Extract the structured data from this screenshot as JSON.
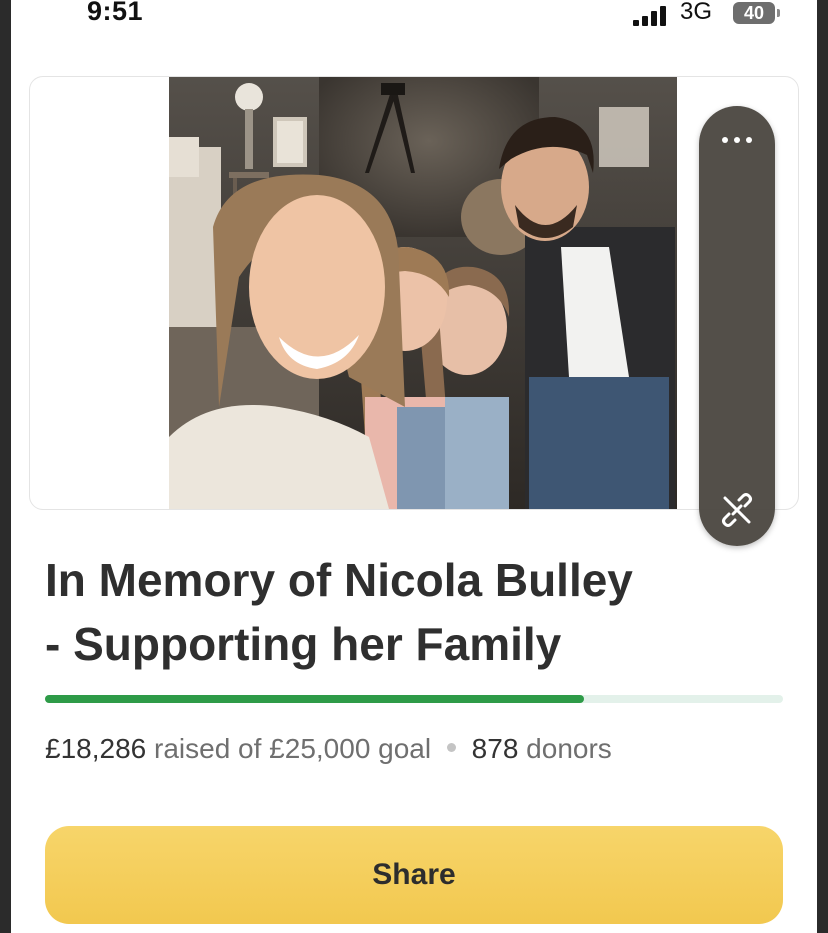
{
  "status_bar": {
    "time": "9:51",
    "network": "3G",
    "battery": "40"
  },
  "hero": {
    "photo_icon": "family-photo",
    "more_icon": "more-horizontal-icon",
    "unlink_icon": "link-off-icon"
  },
  "campaign": {
    "title_line1": "In Memory of Nicola Bulley",
    "title_line2": "- Supporting her Family",
    "progress_fraction": 0.73,
    "raised": "£18,286",
    "raised_of_text": "raised of £25,000 goal",
    "donors_count": "878",
    "donors_label": "donors"
  },
  "actions": {
    "share_label": "Share"
  },
  "colors": {
    "progress": "#2e9b48",
    "progress_track": "#e3f1ea",
    "share_button": "#f3ca52"
  }
}
